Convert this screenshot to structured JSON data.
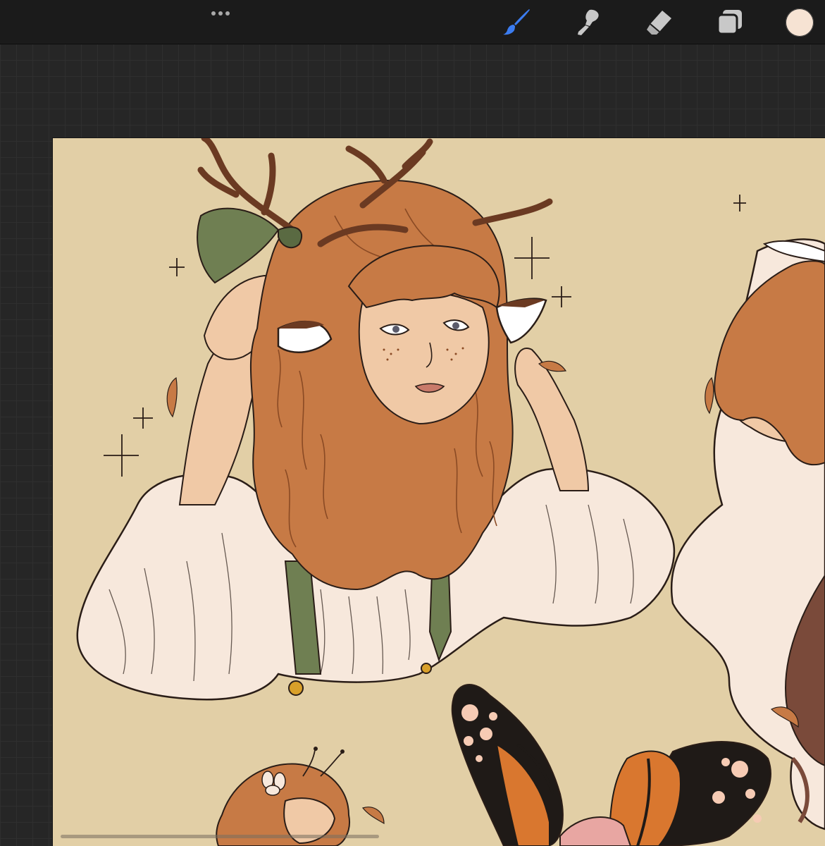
{
  "toolbar": {
    "menu_icon": "more-dots-icon",
    "tools": [
      {
        "name": "brush",
        "icon": "brush-icon",
        "active": true,
        "color": "#3b7cf0"
      },
      {
        "name": "smudge",
        "icon": "smudge-icon",
        "active": false,
        "color": "#c8c8c8"
      },
      {
        "name": "eraser",
        "icon": "eraser-icon",
        "active": false,
        "color": "#c8c8c8"
      },
      {
        "name": "layers",
        "icon": "layers-icon",
        "active": false,
        "color": "#c8c8c8"
      }
    ],
    "current_color": "#f6e3d3"
  },
  "workspace": {
    "background": "#262626",
    "grid_color": "#2f2f2f"
  },
  "canvas": {
    "paper_color": "#e2cfa6",
    "artwork": "character-sketch-illustration",
    "palette": {
      "hair": "#c77a45",
      "skin": "#f0c9a6",
      "shirt": "#f7e8dc",
      "antler": "#6b3a22",
      "bow": "#6f7f52",
      "wing_orange": "#d9772f",
      "wing_black": "#1f1a17",
      "spot": "#f6cbb4",
      "line": "#2a1d17"
    }
  }
}
